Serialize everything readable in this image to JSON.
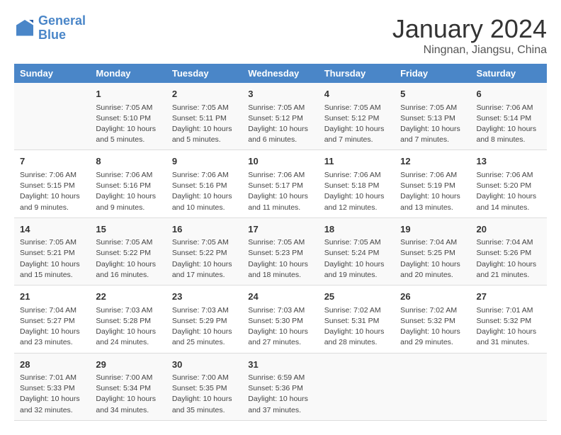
{
  "header": {
    "logo_line1": "General",
    "logo_line2": "Blue",
    "month": "January 2024",
    "location": "Ningnan, Jiangsu, China"
  },
  "days_of_week": [
    "Sunday",
    "Monday",
    "Tuesday",
    "Wednesday",
    "Thursday",
    "Friday",
    "Saturday"
  ],
  "weeks": [
    [
      {
        "num": "",
        "info": ""
      },
      {
        "num": "1",
        "info": "Sunrise: 7:05 AM\nSunset: 5:10 PM\nDaylight: 10 hours\nand 5 minutes."
      },
      {
        "num": "2",
        "info": "Sunrise: 7:05 AM\nSunset: 5:11 PM\nDaylight: 10 hours\nand 5 minutes."
      },
      {
        "num": "3",
        "info": "Sunrise: 7:05 AM\nSunset: 5:12 PM\nDaylight: 10 hours\nand 6 minutes."
      },
      {
        "num": "4",
        "info": "Sunrise: 7:05 AM\nSunset: 5:12 PM\nDaylight: 10 hours\nand 7 minutes."
      },
      {
        "num": "5",
        "info": "Sunrise: 7:05 AM\nSunset: 5:13 PM\nDaylight: 10 hours\nand 7 minutes."
      },
      {
        "num": "6",
        "info": "Sunrise: 7:06 AM\nSunset: 5:14 PM\nDaylight: 10 hours\nand 8 minutes."
      }
    ],
    [
      {
        "num": "7",
        "info": "Sunrise: 7:06 AM\nSunset: 5:15 PM\nDaylight: 10 hours\nand 9 minutes."
      },
      {
        "num": "8",
        "info": "Sunrise: 7:06 AM\nSunset: 5:16 PM\nDaylight: 10 hours\nand 9 minutes."
      },
      {
        "num": "9",
        "info": "Sunrise: 7:06 AM\nSunset: 5:16 PM\nDaylight: 10 hours\nand 10 minutes."
      },
      {
        "num": "10",
        "info": "Sunrise: 7:06 AM\nSunset: 5:17 PM\nDaylight: 10 hours\nand 11 minutes."
      },
      {
        "num": "11",
        "info": "Sunrise: 7:06 AM\nSunset: 5:18 PM\nDaylight: 10 hours\nand 12 minutes."
      },
      {
        "num": "12",
        "info": "Sunrise: 7:06 AM\nSunset: 5:19 PM\nDaylight: 10 hours\nand 13 minutes."
      },
      {
        "num": "13",
        "info": "Sunrise: 7:06 AM\nSunset: 5:20 PM\nDaylight: 10 hours\nand 14 minutes."
      }
    ],
    [
      {
        "num": "14",
        "info": "Sunrise: 7:05 AM\nSunset: 5:21 PM\nDaylight: 10 hours\nand 15 minutes."
      },
      {
        "num": "15",
        "info": "Sunrise: 7:05 AM\nSunset: 5:22 PM\nDaylight: 10 hours\nand 16 minutes."
      },
      {
        "num": "16",
        "info": "Sunrise: 7:05 AM\nSunset: 5:22 PM\nDaylight: 10 hours\nand 17 minutes."
      },
      {
        "num": "17",
        "info": "Sunrise: 7:05 AM\nSunset: 5:23 PM\nDaylight: 10 hours\nand 18 minutes."
      },
      {
        "num": "18",
        "info": "Sunrise: 7:05 AM\nSunset: 5:24 PM\nDaylight: 10 hours\nand 19 minutes."
      },
      {
        "num": "19",
        "info": "Sunrise: 7:04 AM\nSunset: 5:25 PM\nDaylight: 10 hours\nand 20 minutes."
      },
      {
        "num": "20",
        "info": "Sunrise: 7:04 AM\nSunset: 5:26 PM\nDaylight: 10 hours\nand 21 minutes."
      }
    ],
    [
      {
        "num": "21",
        "info": "Sunrise: 7:04 AM\nSunset: 5:27 PM\nDaylight: 10 hours\nand 23 minutes."
      },
      {
        "num": "22",
        "info": "Sunrise: 7:03 AM\nSunset: 5:28 PM\nDaylight: 10 hours\nand 24 minutes."
      },
      {
        "num": "23",
        "info": "Sunrise: 7:03 AM\nSunset: 5:29 PM\nDaylight: 10 hours\nand 25 minutes."
      },
      {
        "num": "24",
        "info": "Sunrise: 7:03 AM\nSunset: 5:30 PM\nDaylight: 10 hours\nand 27 minutes."
      },
      {
        "num": "25",
        "info": "Sunrise: 7:02 AM\nSunset: 5:31 PM\nDaylight: 10 hours\nand 28 minutes."
      },
      {
        "num": "26",
        "info": "Sunrise: 7:02 AM\nSunset: 5:32 PM\nDaylight: 10 hours\nand 29 minutes."
      },
      {
        "num": "27",
        "info": "Sunrise: 7:01 AM\nSunset: 5:32 PM\nDaylight: 10 hours\nand 31 minutes."
      }
    ],
    [
      {
        "num": "28",
        "info": "Sunrise: 7:01 AM\nSunset: 5:33 PM\nDaylight: 10 hours\nand 32 minutes."
      },
      {
        "num": "29",
        "info": "Sunrise: 7:00 AM\nSunset: 5:34 PM\nDaylight: 10 hours\nand 34 minutes."
      },
      {
        "num": "30",
        "info": "Sunrise: 7:00 AM\nSunset: 5:35 PM\nDaylight: 10 hours\nand 35 minutes."
      },
      {
        "num": "31",
        "info": "Sunrise: 6:59 AM\nSunset: 5:36 PM\nDaylight: 10 hours\nand 37 minutes."
      },
      {
        "num": "",
        "info": ""
      },
      {
        "num": "",
        "info": ""
      },
      {
        "num": "",
        "info": ""
      }
    ]
  ]
}
